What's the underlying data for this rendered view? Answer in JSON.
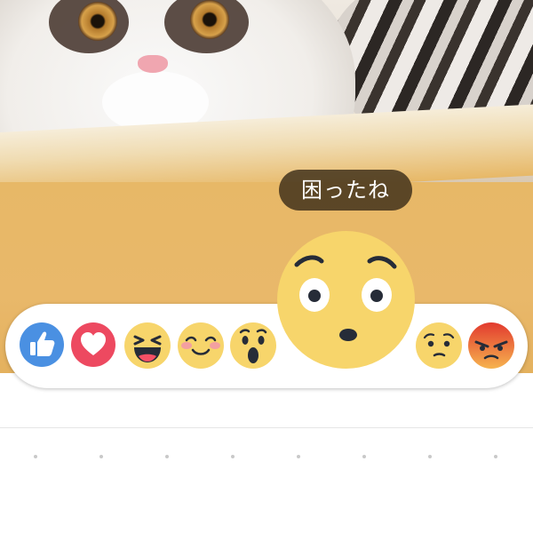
{
  "tooltip": {
    "label": "困ったね"
  },
  "reactions": [
    {
      "id": "like",
      "icon": "thumbs-up-icon",
      "color": "#4a90e2"
    },
    {
      "id": "love",
      "icon": "heart-icon",
      "color": "#ed4960"
    },
    {
      "id": "haha",
      "icon": "laughing-face-icon",
      "color": "#f7d56b"
    },
    {
      "id": "yay",
      "icon": "smiling-blush-face-icon",
      "color": "#f7d56b"
    },
    {
      "id": "wow",
      "icon": "surprised-face-icon",
      "color": "#f7d56b"
    },
    {
      "id": "confused",
      "icon": "confused-face-icon",
      "color": "#f7d56b",
      "selected": true
    },
    {
      "id": "sad",
      "icon": "worried-face-icon",
      "color": "#f7d56b"
    },
    {
      "id": "angry",
      "icon": "angry-face-icon",
      "color": "#e84c3d"
    }
  ],
  "colors": {
    "bar_background": "#ffffff",
    "tooltip_background": "#3c2d19",
    "emoji_yellow": "#f7d56b",
    "like_blue": "#4a90e2",
    "love_red": "#ed4960",
    "angry_red": "#e84c3d"
  }
}
